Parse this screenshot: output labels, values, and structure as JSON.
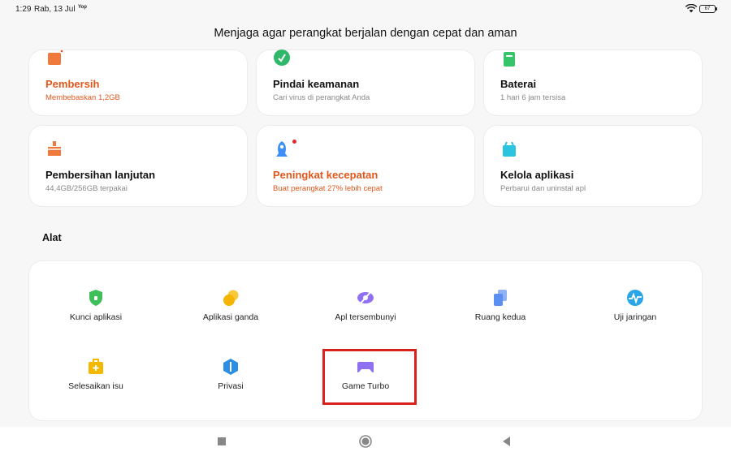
{
  "status_bar": {
    "time": "1:29",
    "date": "Rab, 13 Jul",
    "mini_label": "Yop",
    "battery": "67"
  },
  "header": {
    "title": "Menjaga agar perangkat berjalan dengan cepat dan aman"
  },
  "cards": [
    {
      "title": "Pembersih",
      "subtitle": "Membebaskan 1,2GB",
      "icon": "trash-icon",
      "color": "#f07a3c",
      "accent": true
    },
    {
      "title": "Pindai keamanan",
      "subtitle": "Cari virus di perangkat Anda",
      "icon": "shield-check-icon",
      "color": "#2fb86b",
      "accent": false
    },
    {
      "title": "Baterai",
      "subtitle": "1 hari 6 jam  tersisa",
      "icon": "battery-icon",
      "color": "#36c46a",
      "accent": false
    },
    {
      "title": "Pembersihan lanjutan",
      "subtitle": "44,4GB/256GB terpakai",
      "icon": "broom-icon",
      "color": "#f07a3c",
      "accent": false
    },
    {
      "title": "Peningkat kecepatan",
      "subtitle": "Buat perangkat 27% lebih cepat",
      "icon": "rocket-icon",
      "color": "#3e8ef7",
      "accent": true
    },
    {
      "title": "Kelola aplikasi",
      "subtitle": "Perbarui dan uninstal apl",
      "icon": "apps-icon",
      "color": "#2ac4e0",
      "accent": false
    }
  ],
  "tools_section": {
    "label": "Alat",
    "items": [
      {
        "label": "Kunci aplikasi",
        "icon": "app-lock-icon",
        "color": "#3fbf5a"
      },
      {
        "label": "Aplikasi ganda",
        "icon": "dual-apps-icon",
        "color": "#f5b400"
      },
      {
        "label": "Apl tersembunyi",
        "icon": "hidden-apps-icon",
        "color": "#8f6ff2"
      },
      {
        "label": "Ruang kedua",
        "icon": "second-space-icon",
        "color": "#5a8ef0"
      },
      {
        "label": "Uji jaringan",
        "icon": "network-test-icon",
        "color": "#2aa5e8"
      },
      {
        "label": "Selesaikan isu",
        "icon": "toolbox-icon",
        "color": "#f5b800"
      },
      {
        "label": "Privasi",
        "icon": "privacy-icon",
        "color": "#2c8fe6"
      },
      {
        "label": "Game Turbo",
        "icon": "gamepad-icon",
        "color": "#8f6ff2"
      }
    ]
  },
  "colors": {
    "accent_orange": "#e2571c",
    "highlight_red": "#d9221c",
    "background": "#f7f7f7"
  },
  "nav_bar": {
    "icons": [
      "recents-square-icon",
      "home-circle-icon",
      "back-triangle-icon"
    ]
  }
}
